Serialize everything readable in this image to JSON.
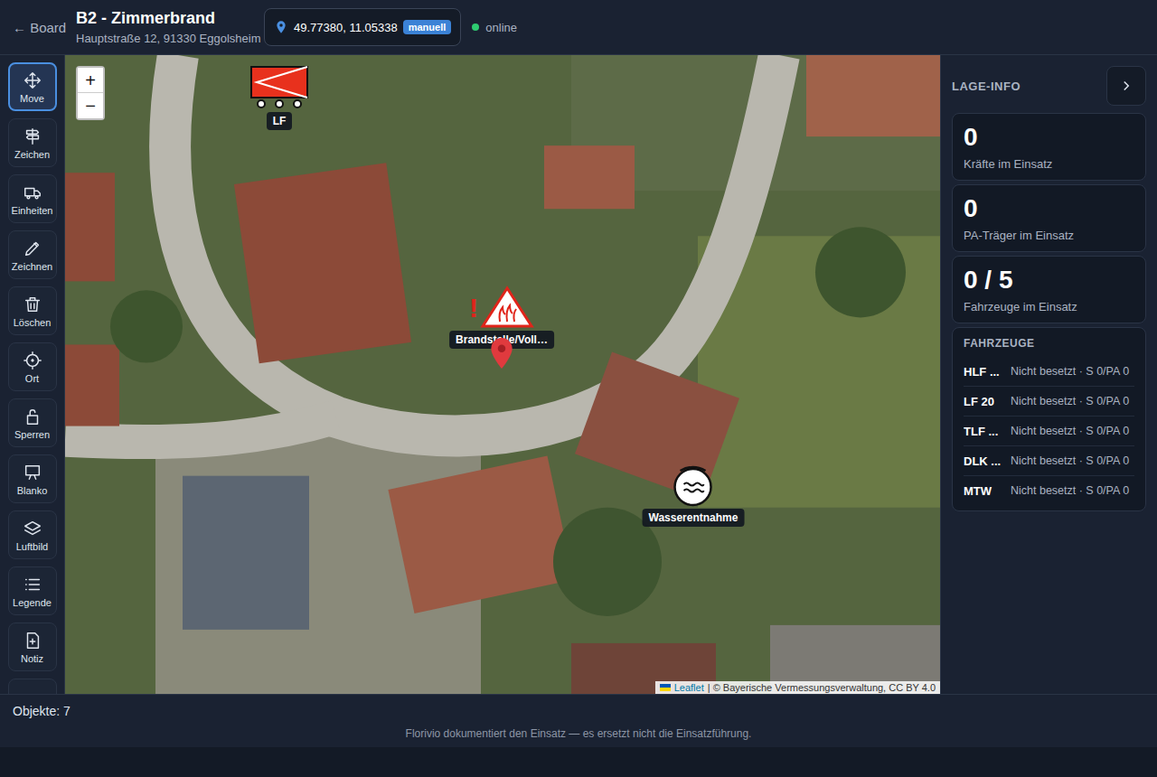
{
  "header": {
    "back": "← Board",
    "title": "B2 - Zimmerbrand",
    "address": "Hauptstraße 12, 91330 Eggolsheim",
    "coordinates": "49.77380, 11.05338",
    "coord_mode": "manuell",
    "status": "online",
    "online": true
  },
  "toolbar": [
    {
      "label": "Move",
      "selected": true
    },
    {
      "label": "Zeichen",
      "selected": false
    },
    {
      "label": "Einheiten",
      "selected": false
    },
    {
      "label": "Zeichnen",
      "selected": false
    },
    {
      "label": "Löschen",
      "selected": false
    },
    {
      "label": "Ort",
      "selected": false
    },
    {
      "label": "Sperren",
      "selected": false
    },
    {
      "label": "Blanko",
      "selected": false
    },
    {
      "label": "Luftbild",
      "selected": false
    },
    {
      "label": "Legende",
      "selected": false
    },
    {
      "label": "Notiz",
      "selected": false
    },
    {
      "label": "",
      "selected": false
    }
  ],
  "map": {
    "zoom_in": "+",
    "zoom_out": "−",
    "attribution_brand": "Leaflet",
    "attribution": "| © Bayerische Vermessungsverwaltung, CC BY 4.0",
    "markers": [
      {
        "kind": "vehicle",
        "label": "LF"
      },
      {
        "kind": "hazard",
        "label": "Brandstelle/Voll…",
        "alert": "!"
      },
      {
        "kind": "pin",
        "label": ""
      },
      {
        "kind": "water",
        "label": "Wasserentnahme"
      }
    ]
  },
  "panel": {
    "title": "LAGE-INFO",
    "stats": [
      {
        "value": "0",
        "label": "Kräfte im Einsatz"
      },
      {
        "value": "0",
        "label": "PA-Träger im Einsatz"
      },
      {
        "value": "0 / 5",
        "label": "Fahrzeuge im Einsatz"
      }
    ],
    "vehicles_title": "FAHRZEUGE",
    "vehicles": [
      {
        "name": "HLF ...",
        "status": "Nicht besetzt · S 0/PA 0"
      },
      {
        "name": "LF 20",
        "status": "Nicht besetzt · S 0/PA 0"
      },
      {
        "name": "TLF ...",
        "status": "Nicht besetzt · S 0/PA 0"
      },
      {
        "name": "DLK ...",
        "status": "Nicht besetzt · S 0/PA 0"
      },
      {
        "name": "MTW",
        "status": "Nicht besetzt · S 0/PA 0"
      }
    ]
  },
  "status_bar": {
    "objects": "Objekte: 7"
  },
  "footer": "Florivio dokumentiert den Einsatz — es ersetzt nicht die Einsatzführung."
}
